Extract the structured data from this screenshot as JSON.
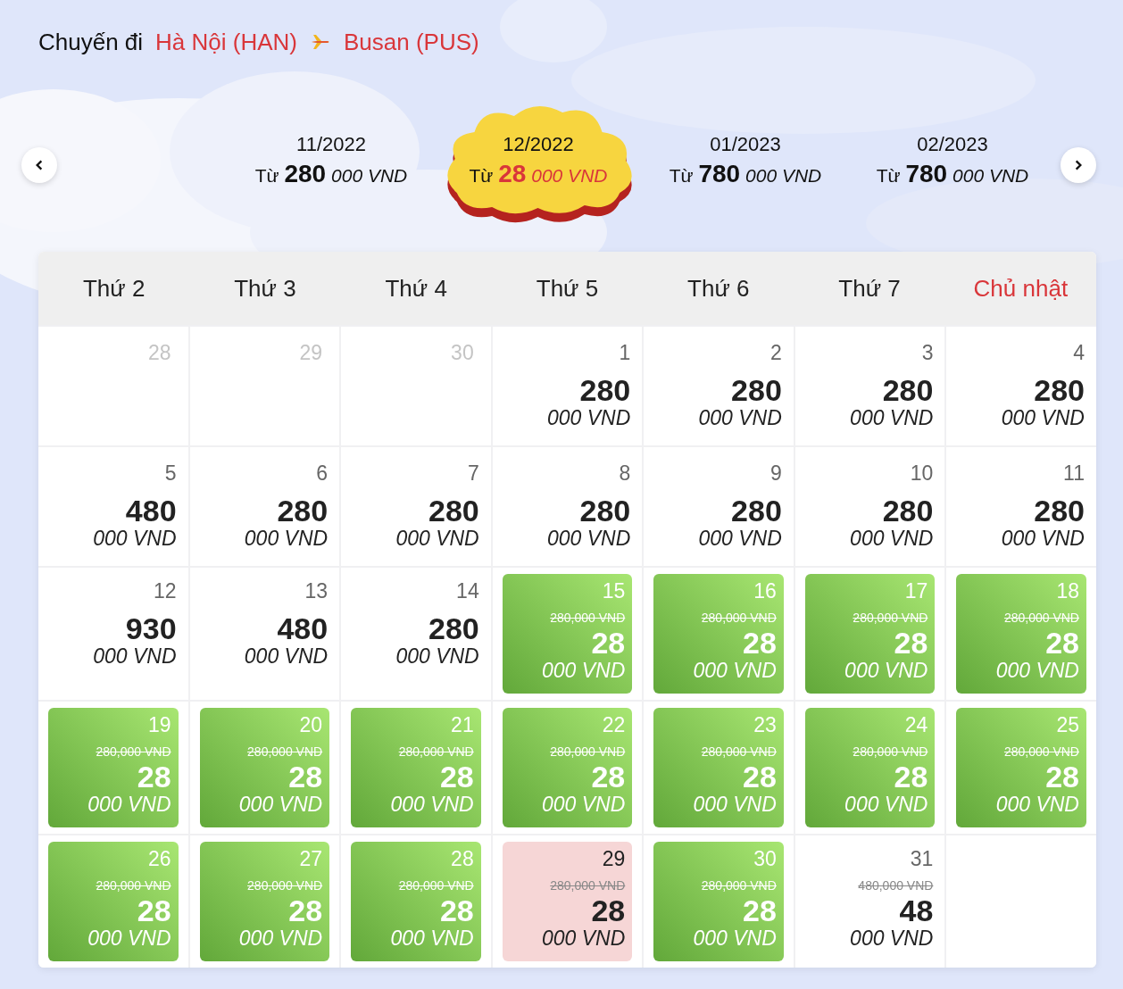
{
  "heading": {
    "label": "Chuyến đi",
    "origin": "Hà Nội (HAN)",
    "destination": "Busan (PUS)"
  },
  "months": [
    {
      "label": "11/2022",
      "prefix": "Từ",
      "amount": "280",
      "unit": "000 VND",
      "selected": false
    },
    {
      "label": "12/2022",
      "prefix": "Từ",
      "amount": "28",
      "unit": "000 VND",
      "selected": true
    },
    {
      "label": "01/2023",
      "prefix": "Từ",
      "amount": "780",
      "unit": "000 VND",
      "selected": false
    },
    {
      "label": "02/2023",
      "prefix": "Từ",
      "amount": "780",
      "unit": "000 VND",
      "selected": false
    }
  ],
  "weekdays": [
    {
      "label": "Thứ 2",
      "kind": "weekday"
    },
    {
      "label": "Thứ 3",
      "kind": "weekday"
    },
    {
      "label": "Thứ 4",
      "kind": "weekday"
    },
    {
      "label": "Thứ 5",
      "kind": "weekday"
    },
    {
      "label": "Thứ 6",
      "kind": "weekday"
    },
    {
      "label": "Thứ 7",
      "kind": "weekday"
    },
    {
      "label": "Chủ nhật",
      "kind": "sunday"
    }
  ],
  "days": [
    {
      "day": "28",
      "kind": "outside"
    },
    {
      "day": "29",
      "kind": "outside"
    },
    {
      "day": "30",
      "kind": "outside"
    },
    {
      "day": "1",
      "kind": "plain",
      "amount": "280",
      "unit": "000 VND"
    },
    {
      "day": "2",
      "kind": "plain",
      "amount": "280",
      "unit": "000 VND"
    },
    {
      "day": "3",
      "kind": "plain",
      "amount": "280",
      "unit": "000 VND"
    },
    {
      "day": "4",
      "kind": "plain",
      "amount": "280",
      "unit": "000 VND"
    },
    {
      "day": "5",
      "kind": "plain",
      "amount": "480",
      "unit": "000 VND"
    },
    {
      "day": "6",
      "kind": "plain",
      "amount": "280",
      "unit": "000 VND"
    },
    {
      "day": "7",
      "kind": "plain",
      "amount": "280",
      "unit": "000 VND"
    },
    {
      "day": "8",
      "kind": "plain",
      "amount": "280",
      "unit": "000 VND"
    },
    {
      "day": "9",
      "kind": "plain",
      "amount": "280",
      "unit": "000 VND"
    },
    {
      "day": "10",
      "kind": "plain",
      "amount": "280",
      "unit": "000 VND"
    },
    {
      "day": "11",
      "kind": "plain",
      "amount": "280",
      "unit": "000 VND"
    },
    {
      "day": "12",
      "kind": "plain",
      "amount": "930",
      "unit": "000 VND"
    },
    {
      "day": "13",
      "kind": "plain",
      "amount": "480",
      "unit": "000 VND"
    },
    {
      "day": "14",
      "kind": "plain",
      "amount": "280",
      "unit": "000 VND"
    },
    {
      "day": "15",
      "kind": "sale",
      "old": "280,000 VND",
      "amount": "28",
      "unit": "000 VND"
    },
    {
      "day": "16",
      "kind": "sale",
      "old": "280,000 VND",
      "amount": "28",
      "unit": "000 VND"
    },
    {
      "day": "17",
      "kind": "sale",
      "old": "280,000 VND",
      "amount": "28",
      "unit": "000 VND"
    },
    {
      "day": "18",
      "kind": "sale",
      "old": "280,000 VND",
      "amount": "28",
      "unit": "000 VND"
    },
    {
      "day": "19",
      "kind": "sale",
      "old": "280,000 VND",
      "amount": "28",
      "unit": "000 VND"
    },
    {
      "day": "20",
      "kind": "sale",
      "old": "280,000 VND",
      "amount": "28",
      "unit": "000 VND"
    },
    {
      "day": "21",
      "kind": "sale",
      "old": "280,000 VND",
      "amount": "28",
      "unit": "000 VND"
    },
    {
      "day": "22",
      "kind": "sale",
      "old": "280,000 VND",
      "amount": "28",
      "unit": "000 VND"
    },
    {
      "day": "23",
      "kind": "sale",
      "old": "280,000 VND",
      "amount": "28",
      "unit": "000 VND"
    },
    {
      "day": "24",
      "kind": "sale",
      "old": "280,000 VND",
      "amount": "28",
      "unit": "000 VND"
    },
    {
      "day": "25",
      "kind": "sale",
      "old": "280,000 VND",
      "amount": "28",
      "unit": "000 VND"
    },
    {
      "day": "26",
      "kind": "sale",
      "old": "280,000 VND",
      "amount": "28",
      "unit": "000 VND"
    },
    {
      "day": "27",
      "kind": "sale",
      "old": "280,000 VND",
      "amount": "28",
      "unit": "000 VND"
    },
    {
      "day": "28",
      "kind": "sale",
      "old": "280,000 VND",
      "amount": "28",
      "unit": "000 VND"
    },
    {
      "day": "29",
      "kind": "highlight",
      "old": "280,000 VND",
      "amount": "28",
      "unit": "000 VND"
    },
    {
      "day": "30",
      "kind": "sale",
      "old": "280,000 VND",
      "amount": "28",
      "unit": "000 VND"
    },
    {
      "day": "31",
      "kind": "discount",
      "old": "480,000 VND",
      "amount": "48",
      "unit": "000 VND"
    },
    {
      "kind": "blank"
    }
  ]
}
